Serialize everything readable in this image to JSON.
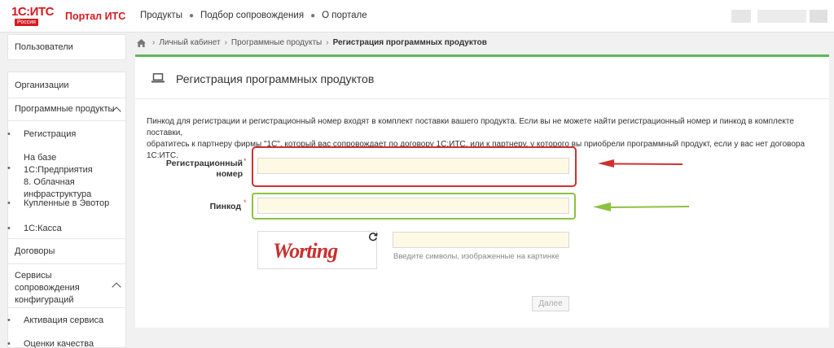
{
  "header": {
    "logo_text": "1С:ИТС",
    "logo_sub": "Россия",
    "portal_title": "Портал ИТС",
    "nav": [
      "Продукты",
      "Подбор сопровождения",
      "О портале"
    ]
  },
  "sidebar": {
    "users": "Пользователи",
    "organizations": "Организации",
    "software_products": "Программные продукты",
    "sub_registration": "Регистрация",
    "sub_cloud_line1": "На базе 1С:Предприятия",
    "sub_cloud_line2": "8. Облачная",
    "sub_cloud_line3": "инфраструктура",
    "sub_evotor": "Купленные в Эвотор",
    "sub_kassa": "1С:Касса",
    "contracts": "Договоры",
    "services_line1": "Сервисы",
    "services_line2": "сопровождения",
    "services_line3": "конфигураций",
    "sub_activation": "Активация сервиса",
    "sub_quality": "Оценки качества"
  },
  "breadcrumb": {
    "items": [
      "Личный кабинет",
      "Программные продукты"
    ],
    "current": "Регистрация программных продуктов"
  },
  "page": {
    "title": "Регистрация программных продуктов",
    "description_line1": "Пинкод для регистрации и регистрационный номер входят в комплект поставки вашего продукта. Если вы не можете найти регистрационный номер и пинкод в комплекте поставки,",
    "description_line2": "обратитесь к партнеру фирмы \"1С\", который вас сопровождает по договору 1С:ИТС, или к партнеру, у которого вы приобрели программный продукт, если у вас нет договора 1С:ИТС."
  },
  "form": {
    "reg_label_line1": "Регистрационный",
    "reg_label_line2": "номер",
    "reg_value": "",
    "pin_label": "Пинкод",
    "pin_value": "",
    "required_mark": "*",
    "captcha_text": "Worting",
    "captcha_value": "",
    "captcha_hint": "Введите символы, изображенные на картинке",
    "next_label": "Далее"
  },
  "colors": {
    "brand_red": "#d71920",
    "highlight_red": "#d32f2f",
    "highlight_green": "#8dc13f",
    "panel_accent": "#5cb85c",
    "input_bg": "#fdf9e4"
  }
}
